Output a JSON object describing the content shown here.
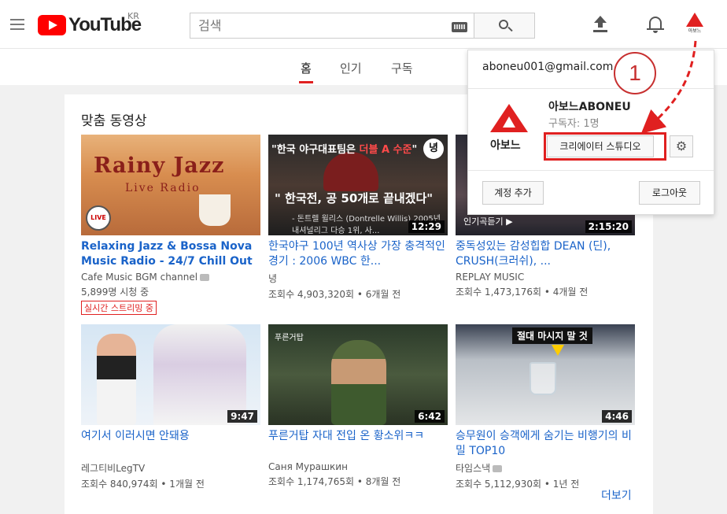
{
  "header": {
    "brand": "YouTube",
    "region": "KR",
    "search_placeholder": "검색",
    "avatar_text": "아보느"
  },
  "tabs": [
    {
      "label": "홈",
      "active": true
    },
    {
      "label": "인기",
      "active": false
    },
    {
      "label": "구독",
      "active": false
    }
  ],
  "section": {
    "title": "맞춤 동영상",
    "more_label": "더보기"
  },
  "videos": [
    {
      "title": "Relaxing Jazz & Bossa Nova Music Radio - 24/7 Chill Out ...",
      "channel": "Cafe Music BGM channel",
      "verified": true,
      "meta": "5,899명 시청 중",
      "live_badge": "실시간 스트리밍 중",
      "thumb_text_1": "Rainy Jazz",
      "thumb_text_2": "Live Radio",
      "thumb_badge": "LIVE"
    },
    {
      "title": "한국야구 100년 역사상 가장 충격적인 경기 : 2006 WBC 한...",
      "channel": "녕",
      "meta": "조회수 4,903,320회 • 6개월 전",
      "duration": "12:29",
      "thumb_head_1": "\"한국 야구대표팀은 ",
      "thumb_head_2": "더블 A 수준",
      "thumb_head_3": "\"",
      "thumb_quote": "\" 한국전, 공 50개로 끝내겠다\"",
      "thumb_sub": "- 돈트렐 윌리스 (Dontrelle Willis) 2005년 내셔널리그 다승 1위, 사...",
      "thumb_circle": "녕"
    },
    {
      "title": "중독성있는 감성힙합 DEAN (딘), CRUSH(크러쉬), ...",
      "channel": "REPLAY MUSIC",
      "meta": "조회수 1,473,176회 • 4개월 전",
      "duration": "2:15:20",
      "thumb_cap": "인기곡듣기 ▶"
    },
    {
      "title": "여기서 이러시면 안돼용",
      "channel": "레그티비LegTV",
      "meta": "조회수 840,974회 • 1개월 전",
      "duration": "9:47"
    },
    {
      "title": "푸른거탑 자대 전입 온 황소위ㅋㅋ",
      "channel": "Саня Мурашкин",
      "meta": "조회수 1,174,765회 • 8개월 전",
      "duration": "6:42",
      "thumb_tag": "푸른거탑"
    },
    {
      "title": "승무원이 승객에게 숨기는 비행기의 비밀 TOP10",
      "channel": "타임스낵",
      "verified": true,
      "meta": "조회수 5,112,930회 • 1년 전",
      "duration": "4:46",
      "thumb_bar": "절대 마시지 말 것"
    }
  ],
  "account_menu": {
    "email": "aboneu001@gmail.com",
    "channel_name": "아보느ABONEU",
    "subscribers": "구독자: 1명",
    "logo_text": "아보느",
    "studio_button": "크리에이터 스튜디오",
    "add_account": "계정 추가",
    "logout": "로그아웃"
  },
  "annotation": {
    "step_number": "1",
    "color": "#e02020"
  }
}
